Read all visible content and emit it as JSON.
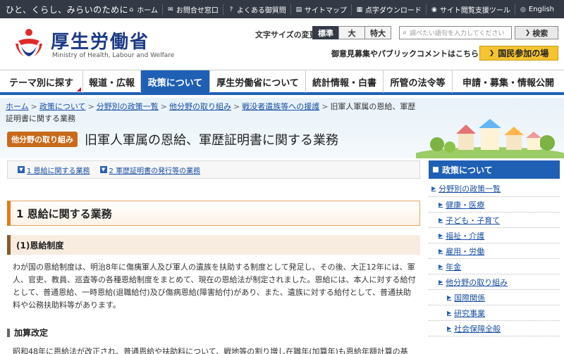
{
  "topbar": {
    "tagline": "ひと、くらし、みらいのために",
    "links": [
      {
        "icon": "home-icon",
        "glyph": "⌂",
        "label": "ホーム"
      },
      {
        "icon": "mail-icon",
        "glyph": "✉",
        "label": "お問合せ窓口"
      },
      {
        "icon": "question-icon",
        "glyph": "?",
        "label": "よくある御質問"
      },
      {
        "icon": "sitemap-icon",
        "glyph": "▤",
        "label": "サイトマップ"
      },
      {
        "icon": "braille-icon",
        "glyph": "▦",
        "label": "点字ダウンロード"
      },
      {
        "icon": "accessibility-icon",
        "glyph": "◉",
        "label": "サイト閲覧支援ツール"
      },
      {
        "icon": "globe-icon",
        "glyph": "◎",
        "label": "English"
      }
    ]
  },
  "header": {
    "logo_text": "厚生労働省",
    "logo_sub": "Ministry of Health, Labour and Welfare",
    "font_size_label": "文字サイズの変更",
    "font_sizes": [
      "標準",
      "大",
      "特大"
    ],
    "search_placeholder": "調べたい語句を入力してください",
    "search_button": "検索",
    "public_comment_text": "御意見募集やパブリックコメントはこちら",
    "public_button": "国民参加の場"
  },
  "nav": {
    "items": [
      "テーマ別に探す",
      "報道・広報",
      "政策について",
      "厚生労働省について",
      "統計情報・白書",
      "所管の法令等",
      "申請・募集・情報公開"
    ]
  },
  "breadcrumb": {
    "items": [
      "ホーム",
      "政策について",
      "分野別の政策一覧",
      "他分野の取り組み",
      "戦没者遺族等への援護"
    ],
    "current": "旧軍人軍属の恩給、軍歴証明書に関する業務"
  },
  "page": {
    "category_badge": "他分野の取り組み",
    "title": "旧軍人軍属の恩給、軍歴証明書に関する業務"
  },
  "toc": {
    "items": [
      "1 恩給に関する業務",
      "2 軍歴証明書の発行等の業務"
    ]
  },
  "content": {
    "h2": "1 恩給に関する業務",
    "h3": "(1)恩給制度",
    "para1": "わが国の恩給制度は、明治8年に傷痍軍人及び軍人の遺族を扶助する制度として発足し、その後、大正12年には、軍人、官吏、教員、巡査等の各種恩給制度をまとめて、現在の恩給法が制定されました。恩給には、本人に対する給付として、普通恩給、一時恩給(退職給付)及び傷病恩給(障害給付)があり、また、遺族に対する給付として、普通扶助料や公務扶助料等があります。",
    "h4": "加算改定",
    "para2": "昭和48年に恩給法が改正され、普通恩給や扶助料について、戦地等の割り増し在職年(加算年)も恩給年額計算の基"
  },
  "sidebar": {
    "title": "政策について",
    "items": [
      {
        "level": "l1",
        "label": "分野別の政策一覧"
      },
      {
        "level": "l2",
        "label": "健康・医療"
      },
      {
        "level": "l2",
        "label": "子ども・子育て"
      },
      {
        "level": "l2",
        "label": "福祉・介護"
      },
      {
        "level": "l2",
        "label": "雇用・労働"
      },
      {
        "level": "l2",
        "label": "年金"
      },
      {
        "level": "l2",
        "label": "他分野の取り組み"
      },
      {
        "level": "l3",
        "label": "国際関係"
      },
      {
        "level": "l3",
        "label": "研究事業"
      },
      {
        "level": "l3",
        "label": "社会保障全般"
      }
    ]
  },
  "colors": {
    "topbar": "#333a45",
    "nav_accent": "#2060b4",
    "logo_blue": "#1b3a85",
    "category_badge": "#c86a1b",
    "public_button": "#f6c431"
  }
}
